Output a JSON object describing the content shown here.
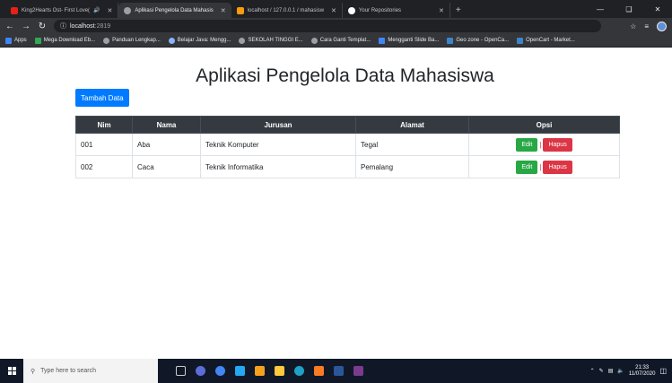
{
  "browser": {
    "tabs": [
      {
        "title": "King2Hearts Ost- First Love(",
        "favicon_color": "#e62117",
        "active": false,
        "audio": true
      },
      {
        "title": "Aplikasi Pengelola Data Mahasis",
        "favicon_color": "#9aa0a6",
        "active": true,
        "audio": false
      },
      {
        "title": "localhost / 127.0.0.1 / mahasisw",
        "favicon_color": "#f89c0e",
        "active": false,
        "audio": false
      },
      {
        "title": "Your Repositories",
        "favicon_color": "#ffffff",
        "active": false,
        "audio": false
      }
    ],
    "new_tab_label": "+",
    "address": {
      "host": "localhost",
      "port": ":2819"
    },
    "bookmarks": [
      {
        "label": "Apps",
        "color": "#4285f4"
      },
      {
        "label": "Mega Download Eb...",
        "color": "#34a853"
      },
      {
        "label": "Panduan Lengkap...",
        "color": "#9aa0a6"
      },
      {
        "label": "Belajar Java: Mengg...",
        "color": "#8ab4f8"
      },
      {
        "label": "SEKOLAH TINGGI E...",
        "color": "#9aa0a6"
      },
      {
        "label": "Cara Ganti Templat...",
        "color": "#9aa0a6"
      },
      {
        "label": "Mengganti Slide Ba...",
        "color": "#4285f4"
      },
      {
        "label": "Geo zone - OpenCa...",
        "color": "#3d85c6"
      },
      {
        "label": "OpenCart - Market...",
        "color": "#3d85c6"
      }
    ]
  },
  "page": {
    "title": "Aplikasi Pengelola Data Mahasiswa",
    "add_button": "Tambah Data",
    "table": {
      "headers": [
        "Nim",
        "Nama",
        "Jurusan",
        "Alamat",
        "Opsi"
      ],
      "rows": [
        {
          "nim": "001",
          "nama": "Aba",
          "jurusan": "Teknik Komputer",
          "alamat": "Tegal"
        },
        {
          "nim": "002",
          "nama": "Caca",
          "jurusan": "Teknik Informatika",
          "alamat": "Pemalang"
        }
      ],
      "edit_label": "Edit",
      "separator": "|",
      "delete_label": "Hapus"
    }
  },
  "taskbar": {
    "search_placeholder": "Type here to search",
    "time": "21:33",
    "date": "11/07/2020"
  },
  "colors": {
    "primary": "#007bff",
    "success": "#28a745",
    "danger": "#dc3545",
    "table_header": "#343a40"
  }
}
